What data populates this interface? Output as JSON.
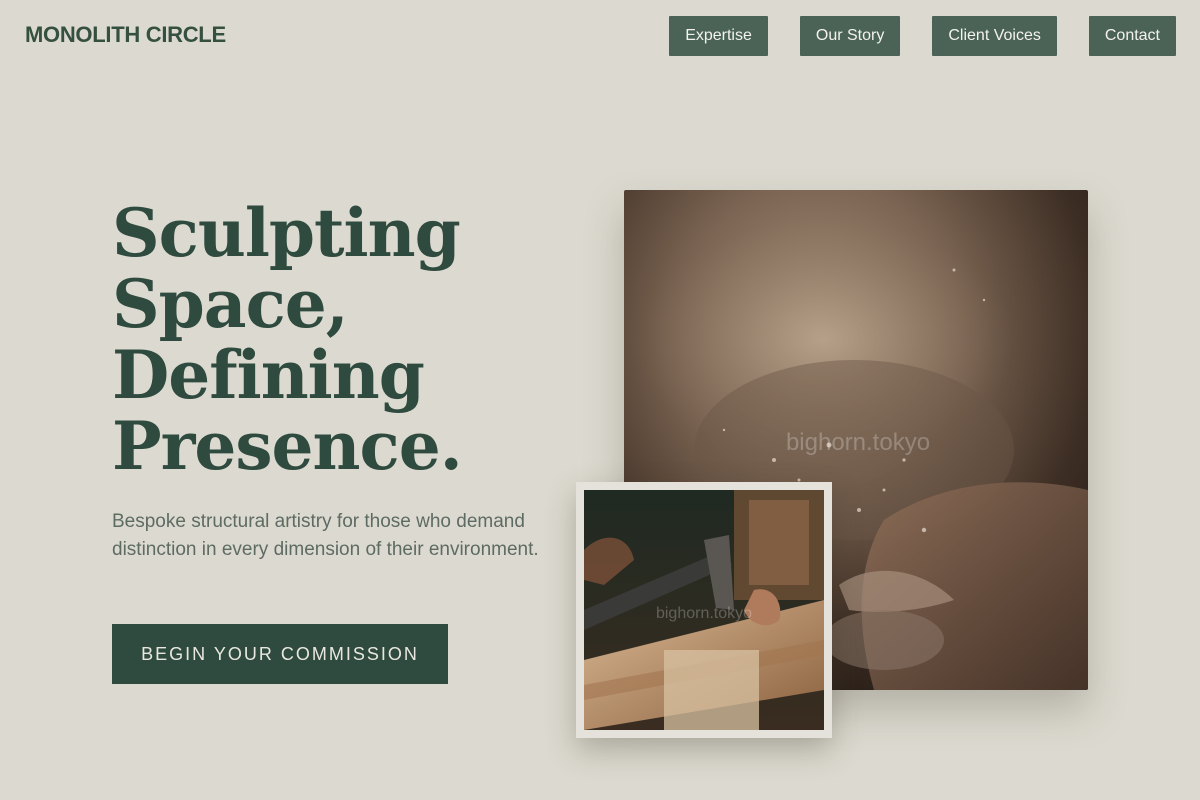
{
  "header": {
    "brand": "MONOLITH CIRCLE",
    "nav": [
      {
        "label": "Expertise"
      },
      {
        "label": "Our Story"
      },
      {
        "label": "Client Voices"
      },
      {
        "label": "Contact"
      }
    ]
  },
  "hero": {
    "headline_lines": [
      "Sculpting",
      "Space,",
      "Defining",
      "Presence."
    ],
    "subtitle": "Bespoke structural artistry for those who demand distinction in every dimension of their environment.",
    "cta_label": "BEGIN YOUR COMMISSION"
  },
  "images": {
    "main": {
      "subject": "hands-shaping-clay-with-dust",
      "watermark": "bighorn.tokyo"
    },
    "secondary": {
      "subject": "woodcarving-with-adze",
      "watermark": "bighorn.tokyo"
    }
  },
  "colors": {
    "background": "#dcdad0",
    "primary_green": "#2f4a3e",
    "nav_button": "#4a6356",
    "text_muted": "#5e6b63"
  }
}
